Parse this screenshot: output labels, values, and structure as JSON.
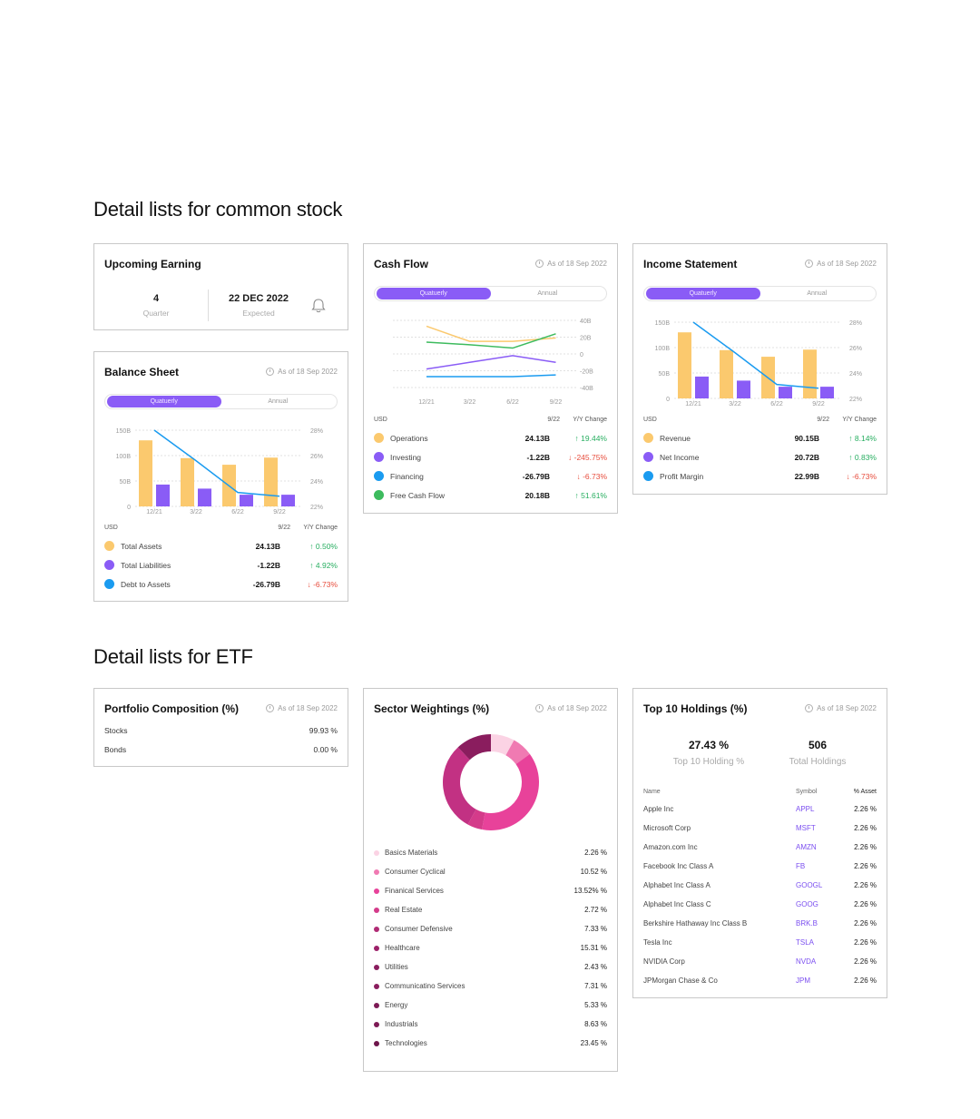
{
  "sections": {
    "stock_title": "Detail lists for common stock",
    "etf_title": "Detail lists for ETF"
  },
  "upcoming": {
    "title": "Upcoming Earning",
    "quarter_value": "4",
    "quarter_label": "Quarter",
    "expected_value": "22 DEC 2022",
    "expected_label": "Expected",
    "icon": "bell-icon"
  },
  "as_of": "As of 18 Sep 2022",
  "toggle": {
    "quarterly": "Quatuerly",
    "annual": "Annual"
  },
  "table_head": {
    "currency": "USD",
    "period": "9/22",
    "change": "Y/Y Change"
  },
  "balance": {
    "title": "Balance Sheet",
    "rows": [
      {
        "label": "Total Assets",
        "value": "24.13B",
        "change": "↑ 0.50%",
        "dir": "up",
        "color": "#fbc96e"
      },
      {
        "label": "Total Liabilities",
        "value": "-1.22B",
        "change": "↑ 4.92%",
        "dir": "up",
        "color": "#8a5cf6"
      },
      {
        "label": "Debt to Assets",
        "value": "-26.79B",
        "change": "↓ -6.73%",
        "dir": "down",
        "color": "#1a9bf0"
      }
    ]
  },
  "cashflow": {
    "title": "Cash Flow",
    "rows": [
      {
        "label": "Operations",
        "value": "24.13B",
        "change": "↑ 19.44%",
        "dir": "up",
        "color": "#fbc96e"
      },
      {
        "label": "Investing",
        "value": "-1.22B",
        "change": "↓ -245.75%",
        "dir": "down",
        "color": "#8a5cf6"
      },
      {
        "label": "Financing",
        "value": "-26.79B",
        "change": "↓ -6.73%",
        "dir": "down",
        "color": "#1a9bf0"
      },
      {
        "label": "Free Cash Flow",
        "value": "20.18B",
        "change": "↑ 51.61%",
        "dir": "up",
        "color": "#3dbb5e"
      }
    ]
  },
  "income": {
    "title": "Income Statement",
    "rows": [
      {
        "label": "Revenue",
        "value": "90.15B",
        "change": "↑ 8.14%",
        "dir": "up",
        "color": "#fbc96e"
      },
      {
        "label": "Net Income",
        "value": "20.72B",
        "change": "↑ 0.83%",
        "dir": "up",
        "color": "#8a5cf6"
      },
      {
        "label": "Profit Margin",
        "value": "22.99B",
        "change": "↓ -6.73%",
        "dir": "down",
        "color": "#1a9bf0"
      }
    ]
  },
  "portfolio": {
    "title": "Portfolio Composition (%)",
    "rows": [
      {
        "label": "Stocks",
        "value": "99.93 %"
      },
      {
        "label": "Bonds",
        "value": "0.00 %"
      }
    ]
  },
  "sector": {
    "title": "Sector Weightings (%)",
    "rows": [
      {
        "label": "Basics Materials",
        "value": "2.26 %",
        "color": "#fbd3e4"
      },
      {
        "label": "Consumer Cyclical",
        "value": "10.52 %",
        "color": "#f07ab2"
      },
      {
        "label": "Finanical Services",
        "value": "13.52% %",
        "color": "#e8429a"
      },
      {
        "label": "Real Estate",
        "value": "2.72 %",
        "color": "#d43b8a"
      },
      {
        "label": "Consumer Defensive",
        "value": "7.33 %",
        "color": "#b02a74"
      },
      {
        "label": "Healthcare",
        "value": "15.31 %",
        "color": "#9c2169"
      },
      {
        "label": "Utilities",
        "value": "2.43 %",
        "color": "#8a1d5e"
      },
      {
        "label": "Communicatino Services",
        "value": "7.31 %",
        "color": "#8a1d5e"
      },
      {
        "label": "Energy",
        "value": "5.33 %",
        "color": "#7d1a55"
      },
      {
        "label": "Industrials",
        "value": "8.63 %",
        "color": "#7d1a55"
      },
      {
        "label": "Technologies",
        "value": "23.45 %",
        "color": "#6e164b"
      }
    ]
  },
  "holdings": {
    "title": "Top 10 Holdings (%)",
    "top_value": "27.43 %",
    "top_label": "Top 10 Holding %",
    "total_value": "506",
    "total_label": "Total Holdings",
    "head": {
      "name": "Name",
      "symbol": "Symbol",
      "asset": "% Asset"
    },
    "rows": [
      {
        "name": "Apple Inc",
        "symbol": "APPL",
        "asset": "2.26 %"
      },
      {
        "name": "Microsoft Corp",
        "symbol": "MSFT",
        "asset": "2.26 %"
      },
      {
        "name": "Amazon.com Inc",
        "symbol": "AMZN",
        "asset": "2.26 %"
      },
      {
        "name": "Facebook Inc Class A",
        "symbol": "FB",
        "asset": "2.26 %"
      },
      {
        "name": "Alphabet Inc Class A",
        "symbol": "GOOGL",
        "asset": "2.26 %"
      },
      {
        "name": "Alphabet Inc Class C",
        "symbol": "GOOG",
        "asset": "2.26 %"
      },
      {
        "name": "Berkshire Hathaway Inc Class B",
        "symbol": "BRK.B",
        "asset": "2.26 %"
      },
      {
        "name": "Tesla Inc",
        "symbol": "TSLA",
        "asset": "2.26 %"
      },
      {
        "name": "NVIDIA Corp",
        "symbol": "NVDA",
        "asset": "2.26 %"
      },
      {
        "name": "JPMorgan Chase & Co",
        "symbol": "JPM",
        "asset": "2.26 %"
      }
    ]
  },
  "chart_data": [
    {
      "name": "balance-sheet-chart",
      "type": "bar",
      "categories": [
        "12/21",
        "3/22",
        "6/22",
        "9/22"
      ],
      "series": [
        {
          "values": [
            130,
            95,
            82,
            96
          ],
          "color": "#fbc96e",
          "kind": "bar"
        },
        {
          "values": [
            43,
            35,
            23,
            23
          ],
          "color": "#8a5cf6",
          "kind": "bar"
        },
        {
          "values": [
            28.0,
            25.6,
            23.1,
            22.8
          ],
          "color": "#1a9bf0",
          "kind": "line",
          "axis": "right"
        }
      ],
      "y_ticks": [
        "150B",
        "100B",
        "50B",
        "0"
      ],
      "y2_ticks": [
        "28%",
        "26%",
        "24%",
        "22%"
      ],
      "ylim": [
        0,
        150
      ],
      "y2lim": [
        22,
        28
      ]
    },
    {
      "name": "cash-flow-chart",
      "type": "line",
      "categories": [
        "12/21",
        "3/22",
        "6/22",
        "9/22"
      ],
      "series": [
        {
          "values": [
            33,
            15,
            15,
            19
          ],
          "color": "#fbc96e"
        },
        {
          "values": [
            14,
            11,
            7,
            24
          ],
          "color": "#3dbb5e"
        },
        {
          "values": [
            -18,
            -10,
            -2,
            -10
          ],
          "color": "#8a5cf6"
        },
        {
          "values": [
            -27,
            -27,
            -27,
            -25
          ],
          "color": "#1a9bf0"
        }
      ],
      "y_ticks": [
        "40B",
        "20B",
        "0",
        "-20B",
        "-40B"
      ],
      "ylim": [
        -40,
        40
      ]
    },
    {
      "name": "income-statement-chart",
      "type": "bar",
      "categories": [
        "12/21",
        "3/22",
        "6/22",
        "9/22"
      ],
      "series": [
        {
          "values": [
            130,
            95,
            82,
            96
          ],
          "color": "#fbc96e",
          "kind": "bar"
        },
        {
          "values": [
            43,
            35,
            23,
            23
          ],
          "color": "#8a5cf6",
          "kind": "bar"
        },
        {
          "values": [
            28.0,
            25.6,
            23.1,
            22.8
          ],
          "color": "#1a9bf0",
          "kind": "line",
          "axis": "right"
        }
      ],
      "y_ticks": [
        "150B",
        "100B",
        "50B",
        "0"
      ],
      "y2_ticks": [
        "28%",
        "26%",
        "24%",
        "22%"
      ],
      "ylim": [
        0,
        150
      ],
      "y2lim": [
        22,
        28
      ]
    },
    {
      "name": "sector-donut-chart",
      "type": "pie",
      "slices": [
        {
          "label": "Basics Materials",
          "value": 8,
          "color": "#fbd3e4"
        },
        {
          "label": "Consumer Cyclical",
          "value": 7,
          "color": "#f07ab2"
        },
        {
          "label": "Finanical Services",
          "value": 38,
          "color": "#e8429a"
        },
        {
          "label": "Real Estate",
          "value": 5,
          "color": "#d43b8a"
        },
        {
          "label": "Consumer Defensive",
          "value": 30,
          "color": "#c23183"
        },
        {
          "label": "Healthcare",
          "value": 12,
          "color": "#8a1d5e"
        }
      ]
    }
  ]
}
